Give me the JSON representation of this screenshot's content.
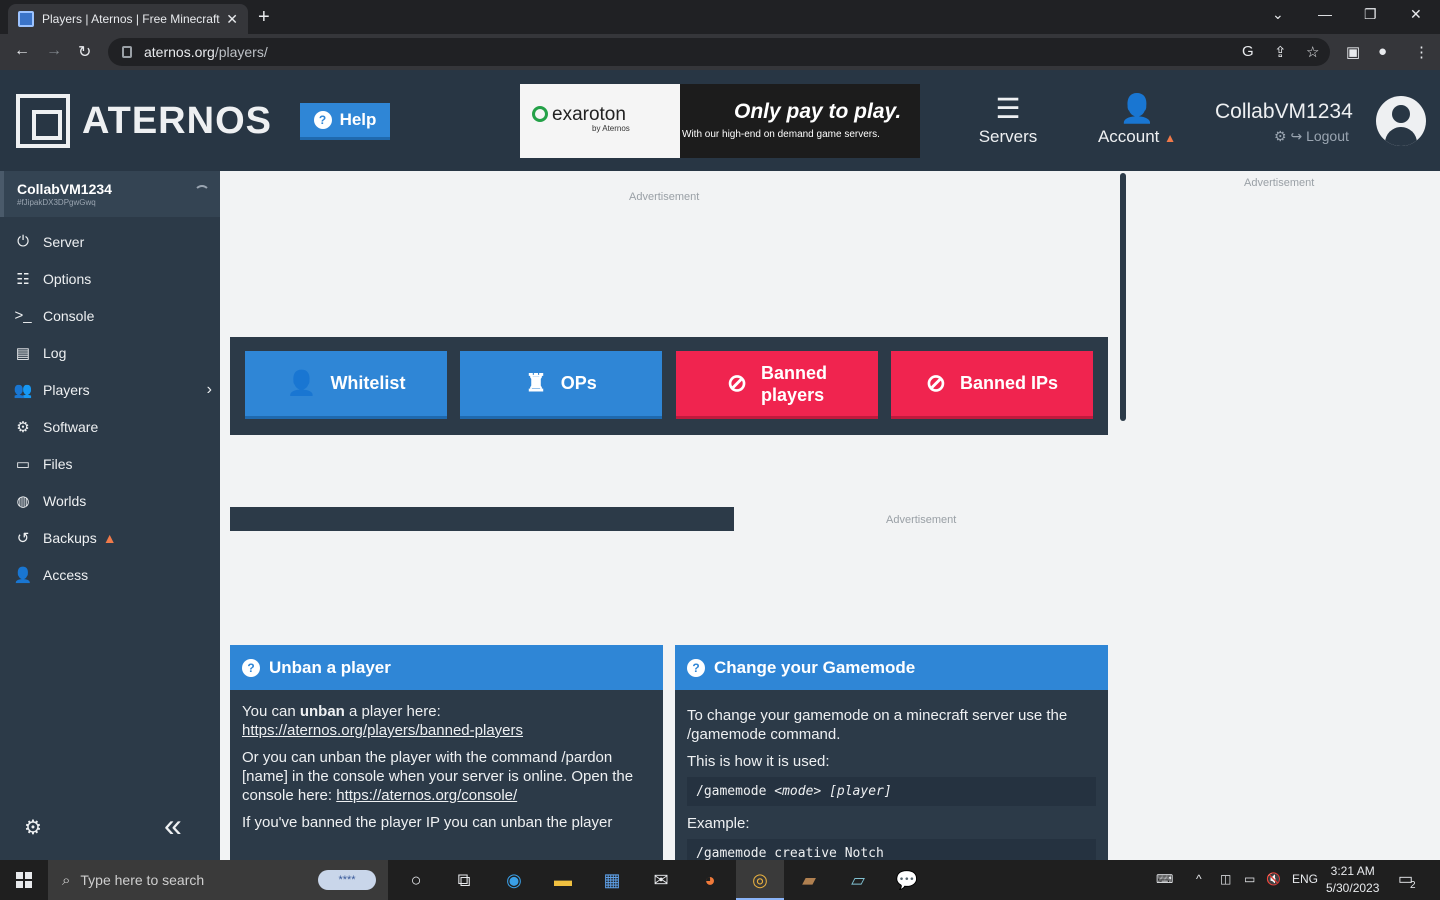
{
  "browser": {
    "tab_title": "Players | Aternos | Free Minecraft",
    "url_host": "aternos.org",
    "url_path": "/players/"
  },
  "header": {
    "logo_text": "ATERNOS",
    "help_label": "Help",
    "ad": {
      "brand": "exaroton",
      "brand_by": "by Aternos",
      "headline": "Only pay to play.",
      "subline": "With our high-end on demand game servers."
    },
    "nav": [
      {
        "label": "Servers",
        "icon": "servers-icon"
      },
      {
        "label": "Account",
        "icon": "account-icon"
      }
    ],
    "user_name": "CollabVM1234",
    "logout_label": "Logout"
  },
  "sidebar": {
    "server_name": "CollabVM1234",
    "server_id": "#fJipakDX3DPgwGwq",
    "items": [
      {
        "label": "Server",
        "icon": "power-icon"
      },
      {
        "label": "Options",
        "icon": "options-icon"
      },
      {
        "label": "Console",
        "icon": "console-icon"
      },
      {
        "label": "Log",
        "icon": "log-icon"
      },
      {
        "label": "Players",
        "icon": "players-icon"
      },
      {
        "label": "Software",
        "icon": "software-icon"
      },
      {
        "label": "Files",
        "icon": "files-icon"
      },
      {
        "label": "Worlds",
        "icon": "worlds-icon"
      },
      {
        "label": "Backups",
        "icon": "backups-icon"
      },
      {
        "label": "Access",
        "icon": "access-icon"
      }
    ]
  },
  "main": {
    "ad_label": "Advertisement",
    "lists": [
      {
        "label": "Whitelist",
        "icon": "whitelist-icon",
        "color": "#2f86d6"
      },
      {
        "label": "OPs",
        "icon": "ops-icon",
        "color": "#2f86d6"
      },
      {
        "label_line1": "Banned",
        "label_line2": "players",
        "icon": "banned-players-icon",
        "color": "#f0244f"
      },
      {
        "label": "Banned IPs",
        "icon": "banned-ips-icon",
        "color": "#f0244f"
      }
    ],
    "unban_card": {
      "title": "Unban a player",
      "p1_pre": "You can ",
      "p1_bold": "unban",
      "p1_post": " a player here: ",
      "p1_link": "https://aternos.org/players/banned-players",
      "p2_pre": "Or you can unban the player with the command /pardon [name] in the console when your server is online. Open the console here: ",
      "p2_link": "https://aternos.org/console/",
      "p3_cut": "If you've banned the player IP you can unban the player"
    },
    "gamemode_card": {
      "title": "Change your Gamemode",
      "p1": "To change your gamemode on a minecraft server use the /gamemode command.",
      "p2": "This is how it is used:",
      "code1_cmd": "/gamemode ",
      "code1_arg1": "<mode>",
      "code1_arg2": "[player]",
      "p3": "Example:",
      "code2": "/gamemode creative Notch"
    }
  },
  "taskbar": {
    "search_placeholder": "Type here to search",
    "lang": "ENG",
    "time": "3:21 AM",
    "date": "5/30/2023",
    "notif_count": "2"
  }
}
